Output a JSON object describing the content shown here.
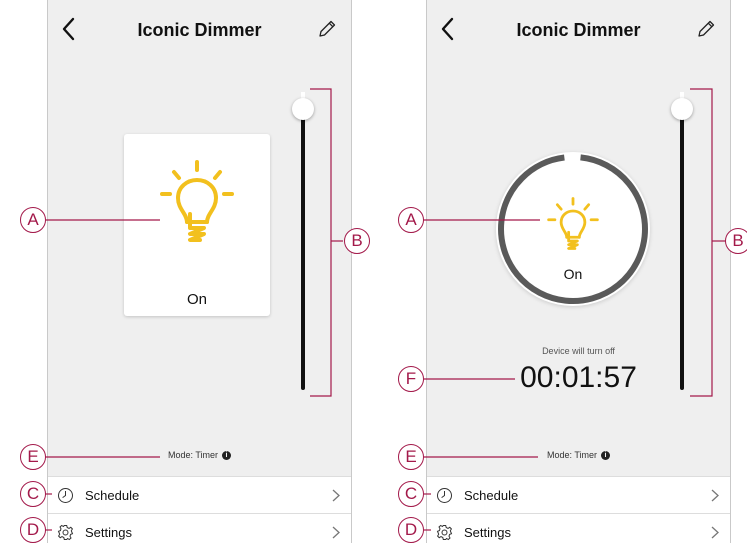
{
  "screens": [
    {
      "title": "Iconic Dimmer",
      "state": "On",
      "mode_text": "Mode: Timer",
      "info_icon": "i",
      "rows": [
        {
          "icon": "clock-icon",
          "label": "Schedule"
        },
        {
          "icon": "gear-icon",
          "label": "Settings"
        }
      ]
    },
    {
      "title": "Iconic Dimmer",
      "state": "On",
      "device_label": "Device will turn off",
      "countdown": "00:01:57",
      "mode_text": "Mode: Timer",
      "info_icon": "i",
      "rows": [
        {
          "icon": "clock-icon",
          "label": "Schedule"
        },
        {
          "icon": "gear-icon",
          "label": "Settings"
        }
      ]
    }
  ],
  "callouts": {
    "a": "A",
    "b": "B",
    "c": "C",
    "d": "D",
    "e": "E",
    "f": "F"
  },
  "colors": {
    "bulb": "#f2c01e",
    "callout": "#a3194a",
    "track": "#111111",
    "ring": "#5a5a5a"
  }
}
